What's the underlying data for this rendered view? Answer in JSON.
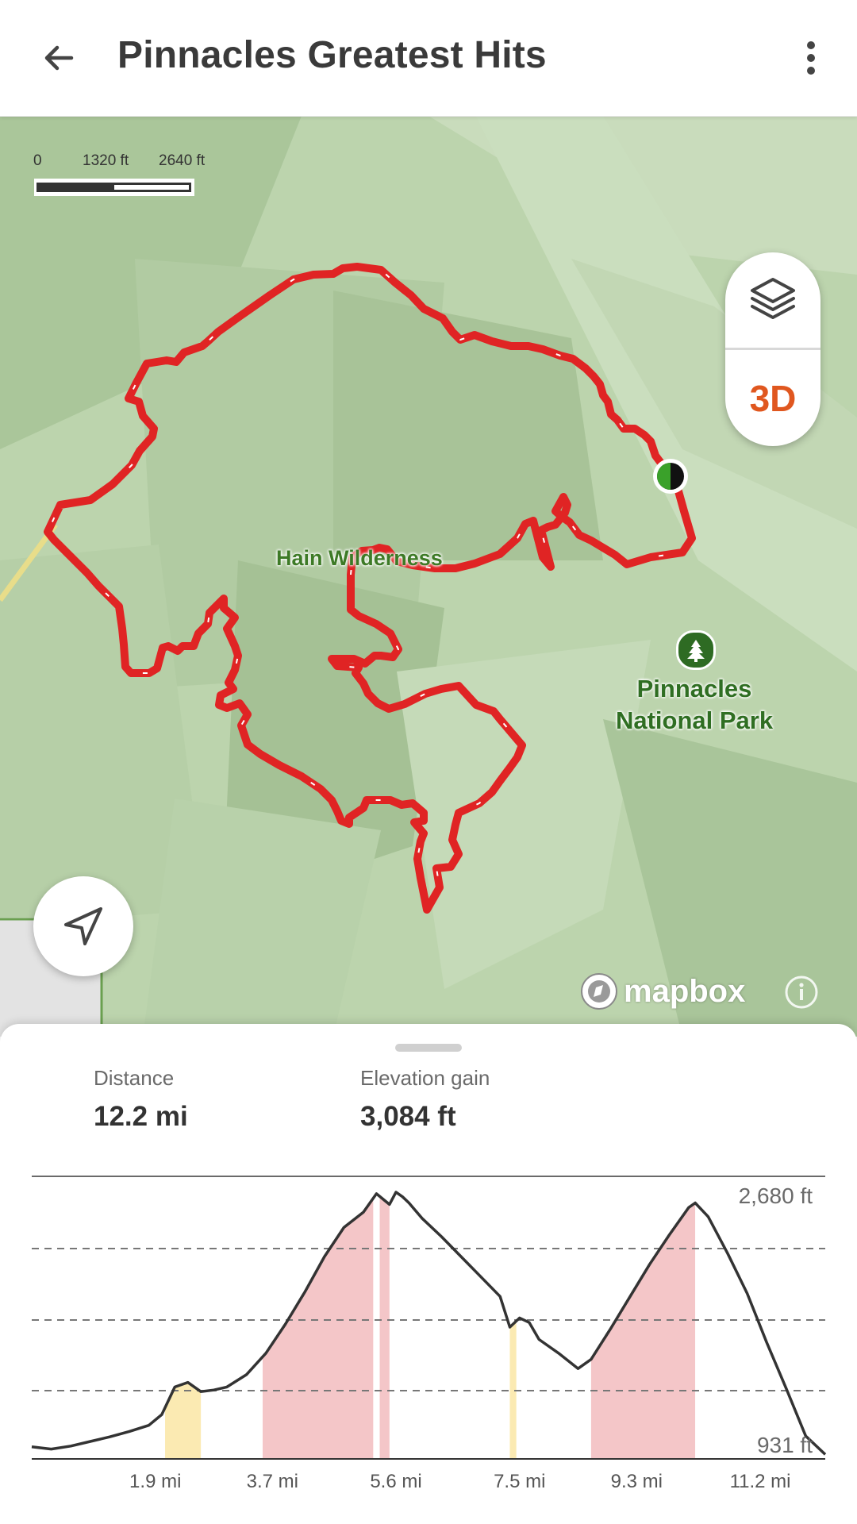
{
  "appbar": {
    "title": "Pinnacles Greatest Hits",
    "back_icon": "arrow-left-icon",
    "more_icon": "more-vertical-icon"
  },
  "map": {
    "scale": {
      "labels": [
        "0",
        "1320 ft",
        "2640 ft"
      ]
    },
    "layers_icon": "layers-icon",
    "button_3d_label": "3D",
    "locate_icon": "navigation-arrow-icon",
    "wilderness_label": "Hain Wilderness",
    "park_label_line1": "Pinnacles",
    "park_label_line2": "National Park",
    "park_icon": "tree-icon",
    "attribution": "mapbox",
    "info_icon": "info-icon",
    "colors": {
      "route": "#e02424",
      "accent": "#e0571f",
      "park_green": "#2e6b23"
    }
  },
  "stats": {
    "distance_label": "Distance",
    "distance_value": "12.2 mi",
    "elevation_label": "Elevation gain",
    "elevation_value": "3,084 ft"
  },
  "chart_data": {
    "type": "area",
    "x_unit": "mi",
    "y_unit": "ft",
    "xlim": [
      0,
      12.2
    ],
    "ylim": [
      931,
      2680
    ],
    "y_tick_labels": [
      "2,680 ft",
      "931 ft"
    ],
    "x_tick_labels": [
      "1.9 mi",
      "3.7 mi",
      "5.6 mi",
      "7.5 mi",
      "9.3 mi",
      "11.2 mi"
    ],
    "x_ticks": [
      1.9,
      3.7,
      5.6,
      7.5,
      9.3,
      11.2
    ],
    "grid": true,
    "x": [
      0,
      0.3,
      0.6,
      0.9,
      1.2,
      1.5,
      1.8,
      2.0,
      2.2,
      2.4,
      2.6,
      2.8,
      3.0,
      3.3,
      3.6,
      3.9,
      4.2,
      4.5,
      4.8,
      5.1,
      5.3,
      5.5,
      5.6,
      5.7,
      5.8,
      6.0,
      6.3,
      6.6,
      6.9,
      7.2,
      7.35,
      7.5,
      7.65,
      7.8,
      8.1,
      8.4,
      8.6,
      8.9,
      9.2,
      9.5,
      9.8,
      10.1,
      10.2,
      10.4,
      10.7,
      11.0,
      11.3,
      11.6,
      11.9,
      12.2
    ],
    "y": [
      1010,
      995,
      1015,
      1045,
      1075,
      1110,
      1150,
      1220,
      1400,
      1430,
      1370,
      1380,
      1400,
      1480,
      1620,
      1810,
      2020,
      2250,
      2440,
      2540,
      2660,
      2590,
      2670,
      2640,
      2600,
      2500,
      2380,
      2250,
      2120,
      1990,
      1790,
      1850,
      1820,
      1710,
      1620,
      1520,
      1580,
      1780,
      1990,
      2200,
      2390,
      2570,
      2600,
      2510,
      2270,
      2010,
      1690,
      1390,
      1080,
      960
    ],
    "steep_segments": [
      {
        "from": 2.05,
        "to": 2.6,
        "grade": "moderate",
        "color": "#fbeab2"
      },
      {
        "from": 3.55,
        "to": 5.25,
        "grade": "steep",
        "color": "#f4c6c8"
      },
      {
        "from": 5.35,
        "to": 5.5,
        "grade": "steep",
        "color": "#f4c6c8"
      },
      {
        "from": 7.35,
        "to": 7.45,
        "grade": "moderate",
        "color": "#fbeab2"
      },
      {
        "from": 8.6,
        "to": 10.2,
        "grade": "steep",
        "color": "#f4c6c8"
      }
    ]
  }
}
